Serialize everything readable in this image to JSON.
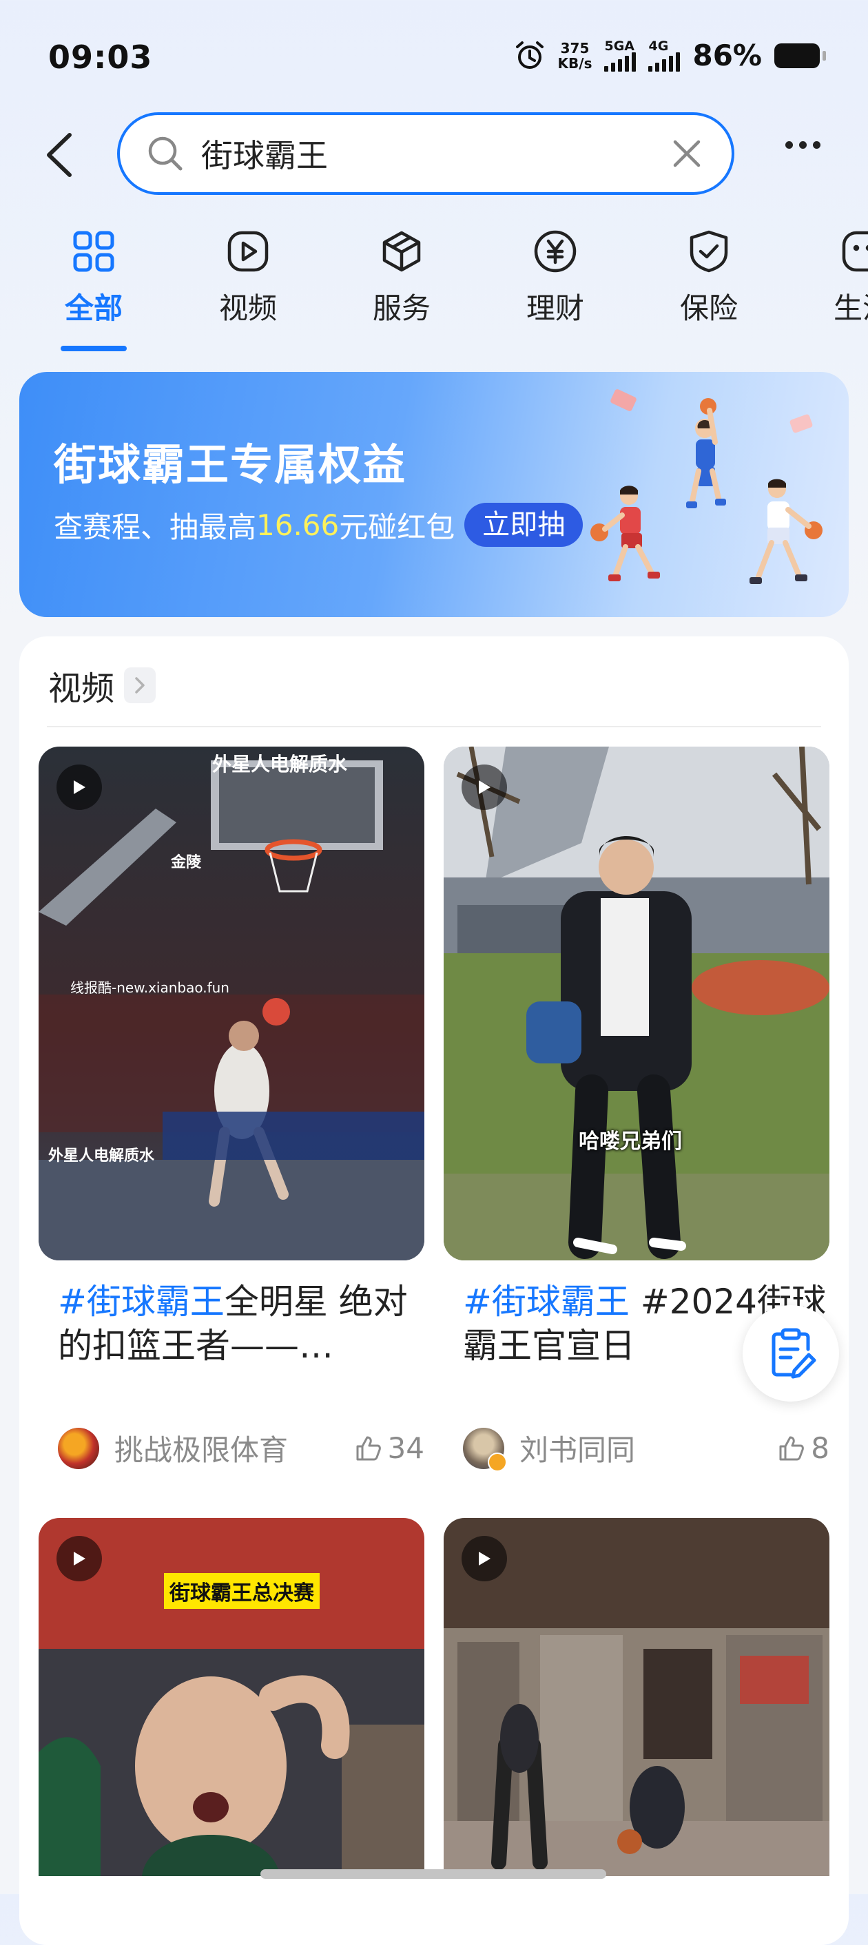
{
  "status_bar": {
    "time": "09:03",
    "net_speed_value": "375",
    "net_speed_unit": "KB/s",
    "sim1_label": "5GA",
    "sim2_label": "4G",
    "battery": "86%"
  },
  "search": {
    "query": "街球霸王"
  },
  "tabs": [
    {
      "label": "全部",
      "icon": "grid-icon",
      "active": true
    },
    {
      "label": "视频",
      "icon": "play-icon"
    },
    {
      "label": "服务",
      "icon": "cube-icon"
    },
    {
      "label": "理财",
      "icon": "yen-icon"
    },
    {
      "label": "保险",
      "icon": "shield-check-icon"
    },
    {
      "label": "生活",
      "icon": "face-icon"
    }
  ],
  "banner": {
    "title": "街球霸王专属权益",
    "sub_prefix": "查赛程、抽最高",
    "sub_amount": "16.66",
    "sub_suffix": "元碰红包",
    "cta": "立即抽"
  },
  "video_section": {
    "title": "视频",
    "items": [
      {
        "tag": "#街球霸王",
        "title_rest": "全明星  绝对的扣篮王者——…",
        "author": "挑战极限体育",
        "likes": "34",
        "watermark": "线报酷-new.xianbao.fun",
        "thumb_text_1": "外星人电解质水",
        "thumb_text_2": "外星人电解质水",
        "thumb_text_3": "金陵"
      },
      {
        "tag": "#街球霸王",
        "title_rest": " #2024街球霸王官宣日",
        "author": "刘书同同",
        "likes": "8",
        "caption": "哈喽兄弟们"
      },
      {
        "caption": "街球霸王总决赛"
      },
      {}
    ]
  },
  "colors": {
    "accent": "#1677ff",
    "banner_highlight": "#fff15a",
    "cta_bg": "#2d5be3"
  }
}
